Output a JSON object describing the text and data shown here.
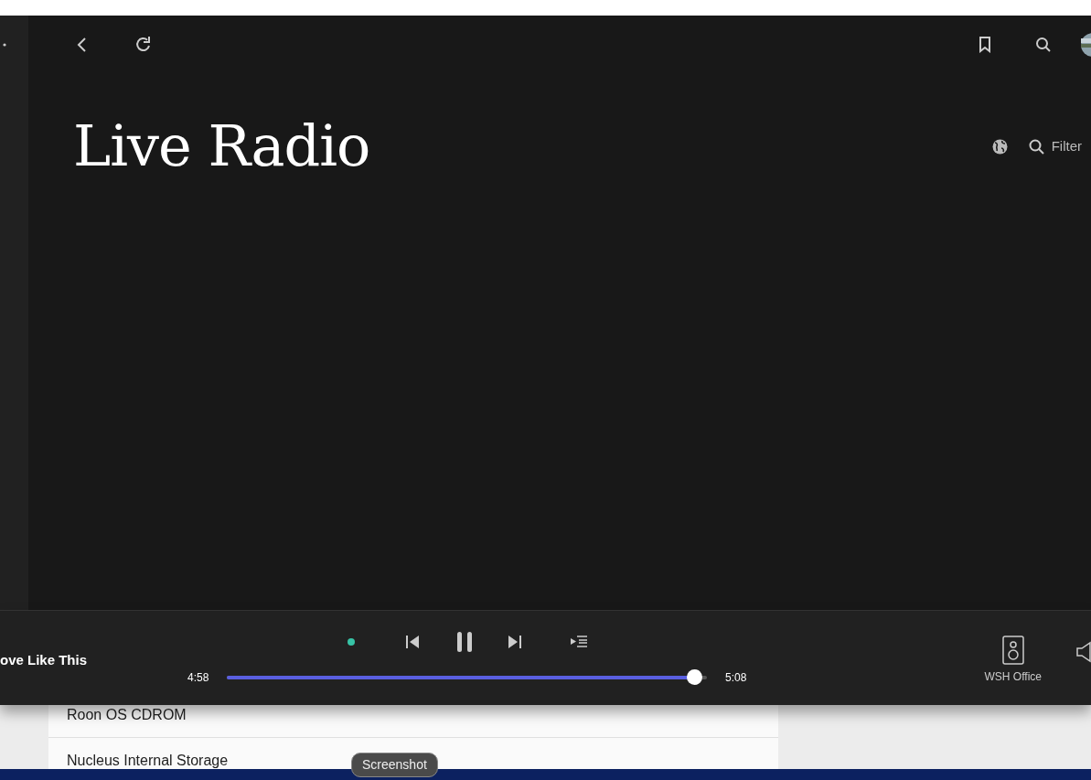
{
  "page": {
    "title": "Live Radio",
    "filter_label": "Filter"
  },
  "player": {
    "track_title": "ove Like This",
    "elapsed": "4:58",
    "duration": "5:08",
    "progress": {
      "level": 0.973
    },
    "playing": true,
    "zone": "WSH Office"
  },
  "storage_list": {
    "rows": [
      "Roon OS CDROM",
      "Nucleus Internal Storage"
    ]
  },
  "taskbar": {
    "tooltip": "Screenshot"
  }
}
